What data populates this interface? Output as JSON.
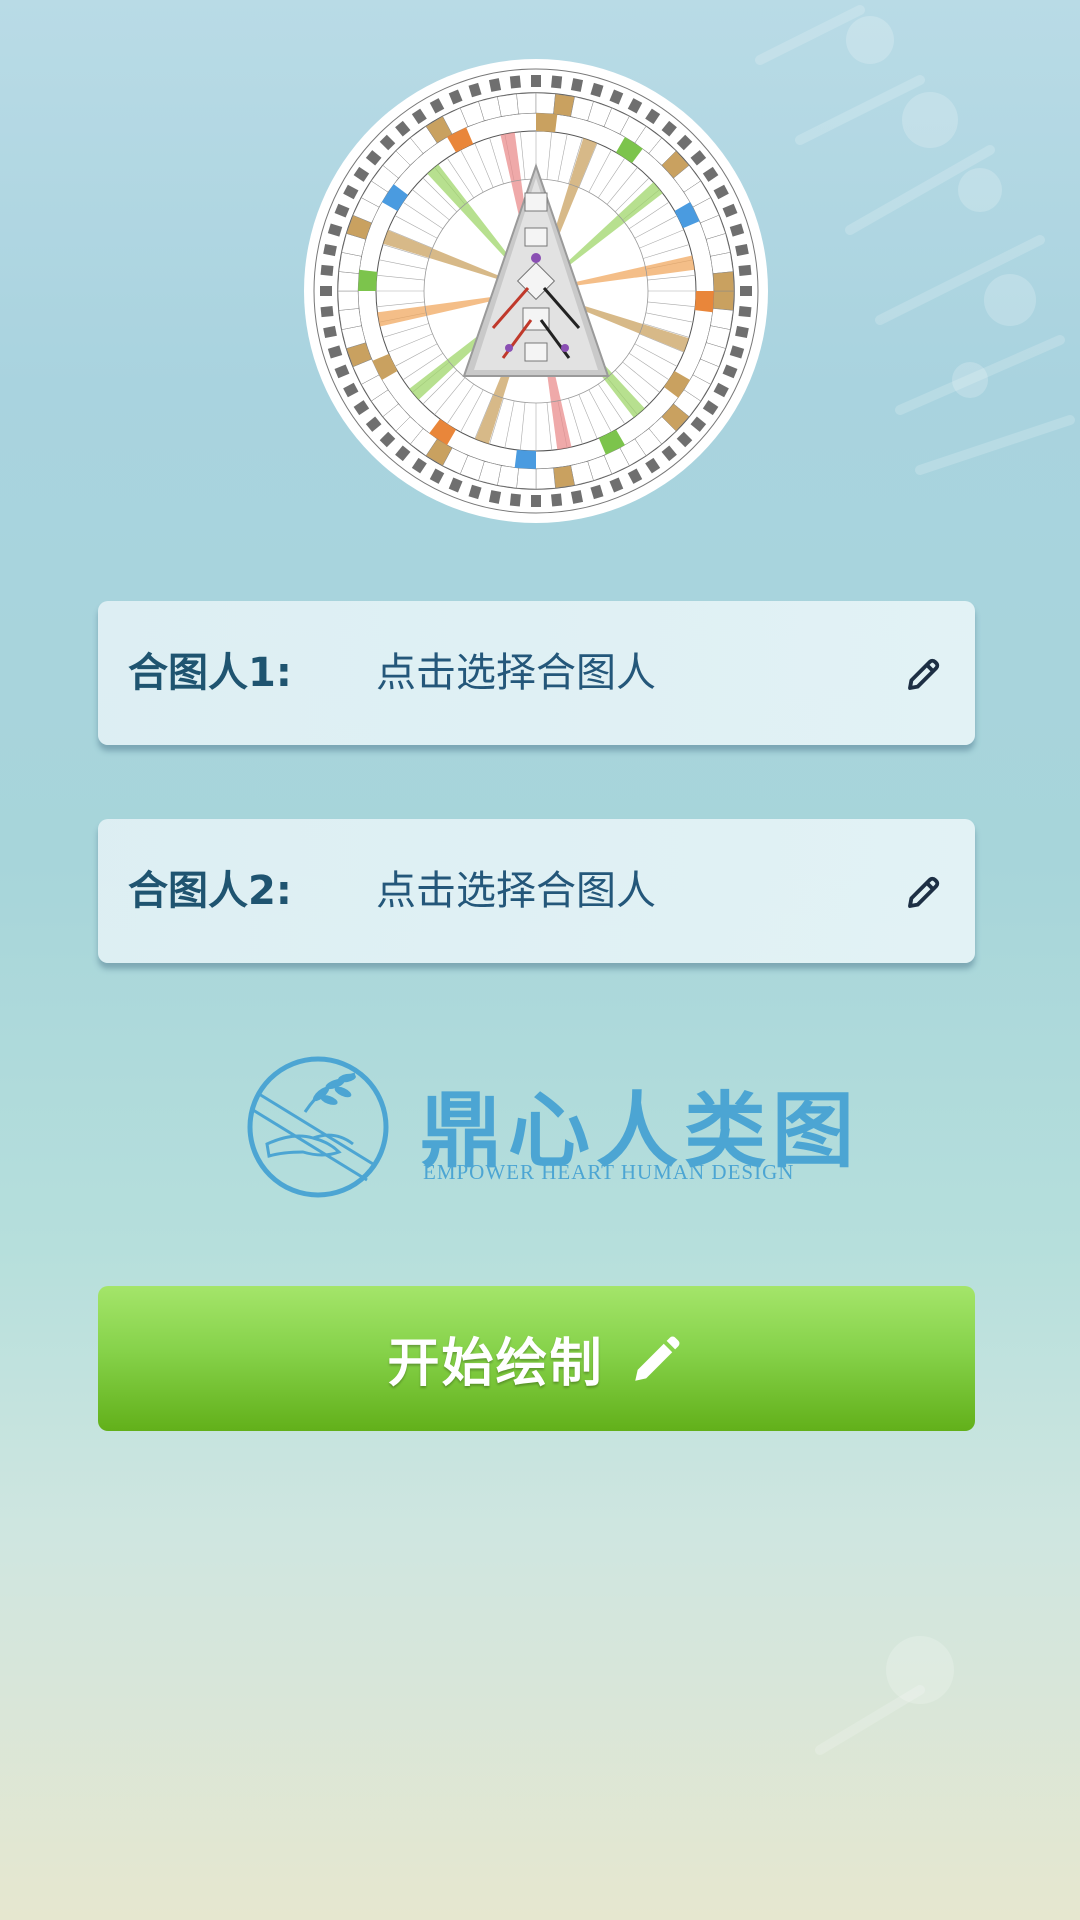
{
  "partners": [
    {
      "label": "合图人1:",
      "value": "点击选择合图人",
      "icon": "pencil-outline-icon"
    },
    {
      "label": "合图人2:",
      "value": "点击选择合图人",
      "icon": "pencil-outline-icon"
    }
  ],
  "logo": {
    "title": "鼎心人类图",
    "subtitle": "EMPOWER  HEART  HUMAN  DESIGN",
    "emblem": "olive-branch-hands-emblem"
  },
  "start_button": {
    "label": "开始绘制",
    "icon": "pencil-solid-icon"
  },
  "colors": {
    "field_text": "#1f5470",
    "logo": "#4ca5d3",
    "button": "#86d24a"
  }
}
